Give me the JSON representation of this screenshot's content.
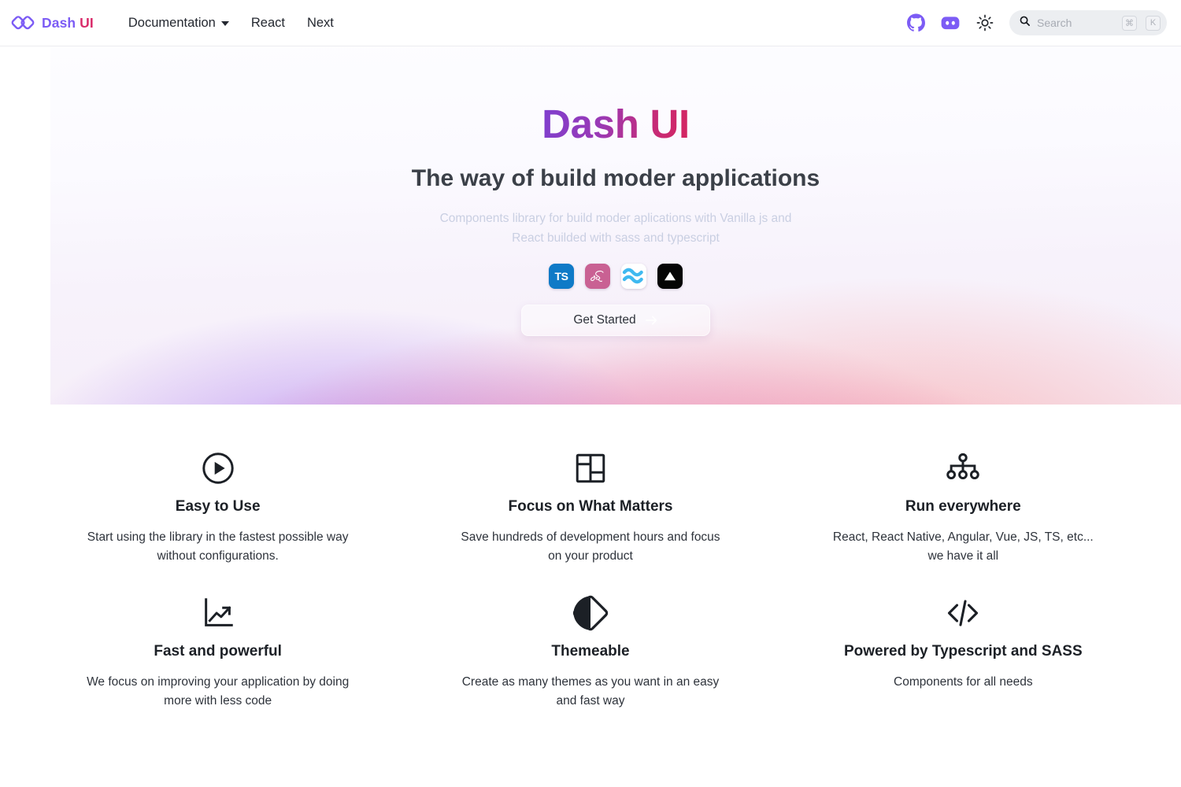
{
  "navbar": {
    "brand": {
      "logo_icon": "infinity-diamonds-logo-icon",
      "name_part1": "Dash",
      "name_part2": "UI"
    },
    "links": [
      {
        "label": "Documentation",
        "has_dropdown": true,
        "icon": "chevron-down-icon"
      },
      {
        "label": "React",
        "has_dropdown": false
      },
      {
        "label": "Next",
        "has_dropdown": false
      }
    ],
    "actions": [
      {
        "name": "github-icon",
        "color": "#7c5cf5"
      },
      {
        "name": "discord-icon",
        "color": "#7c5cf5"
      },
      {
        "name": "sun-theme-icon",
        "color": "#1f2329"
      }
    ],
    "search": {
      "icon": "search-icon",
      "placeholder": "Search",
      "value": "",
      "shortcut_keys": [
        "⌘",
        "K"
      ]
    }
  },
  "hero": {
    "title": "Dash UI",
    "subtitle": "The way of build moder applications",
    "description": "Components library for build moder aplications with Vanilla js and React builded with sass and typescript",
    "tech_icons": [
      {
        "name": "typescript-icon",
        "label": "TS",
        "color": "#0f7ac7"
      },
      {
        "name": "sass-icon",
        "label": "Sass",
        "color": "#c96193"
      },
      {
        "name": "vite-icon",
        "label": "",
        "color": "#ffffff"
      },
      {
        "name": "nextjs-icon",
        "label": "",
        "color": "#050505"
      }
    ],
    "cta": {
      "label": "Get Started",
      "icon": "arrow-right-icon"
    }
  },
  "features": [
    {
      "icon": "play-circle-icon",
      "title": "Easy to Use",
      "description": "Start using the library in the fastest possible way without configurations."
    },
    {
      "icon": "layout-dashboard-icon",
      "title": "Focus on What Matters",
      "description": "Save hundreds of development hours and focus on your product"
    },
    {
      "icon": "sitemap-hierarchy-icon",
      "title": "Run everywhere",
      "description": "React, React Native, Angular, Vue, JS, TS, etc... we have it all"
    },
    {
      "icon": "chart-line-up-icon",
      "title": "Fast and powerful",
      "description": "We focus on improving your application by doing more with less code"
    },
    {
      "icon": "contrast-diamond-icon",
      "title": "Themeable",
      "description": "Create as many themes as you want in an easy and fast way"
    },
    {
      "icon": "code-slash-icon",
      "title": "Powered by Typescript and SASS",
      "description": "Components for all needs"
    }
  ],
  "colors": {
    "brand_purple": "#7c5cf5",
    "brand_pink": "#d92b6a",
    "title_gradient_start": "#7e3fcf",
    "title_gradient_end": "#d5255f",
    "text_dark": "#1c2026",
    "text_muted": "#c9cfe2"
  }
}
